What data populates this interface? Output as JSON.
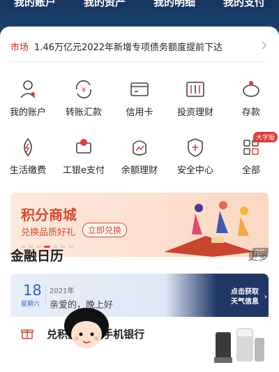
{
  "header_tabs": [
    "我的账户",
    "我的资产",
    "我的明细",
    "我的支付"
  ],
  "news": {
    "tag": "市场",
    "text": "1.46万亿元2022年新增专项债务额度提前下达"
  },
  "grid_row1": [
    {
      "label": "我的账户",
      "icon": "account-icon"
    },
    {
      "label": "转账汇款",
      "icon": "transfer-icon"
    },
    {
      "label": "信用卡",
      "icon": "credit-card-icon"
    },
    {
      "label": "投资理财",
      "icon": "invest-icon"
    },
    {
      "label": "存款",
      "icon": "deposit-icon"
    }
  ],
  "grid_row2": [
    {
      "label": "生活缴费",
      "icon": "utility-icon"
    },
    {
      "label": "工银e支付",
      "icon": "epay-icon"
    },
    {
      "label": "余额理财",
      "icon": "balance-icon"
    },
    {
      "label": "安全中心",
      "icon": "security-icon"
    },
    {
      "label": "全部",
      "icon": "all-icon",
      "badge": "大字版"
    }
  ],
  "banner": {
    "title": "积分商城",
    "subtitle": "兑换品质好礼",
    "button": "立即兑换",
    "ad_label": "广告"
  },
  "finance_calendar": {
    "title": "金融日历",
    "more": "更多",
    "day": "18",
    "weekday": "星期六",
    "year": "2021年",
    "greeting": "亲爱的，晚上好",
    "weather_line1": "点击获取",
    "weather_line2": "天气信息"
  },
  "promo": {
    "text": "兑积分 就上手机银行"
  },
  "colors": {
    "accent": "#d7261c",
    "header": "#1e4676"
  }
}
